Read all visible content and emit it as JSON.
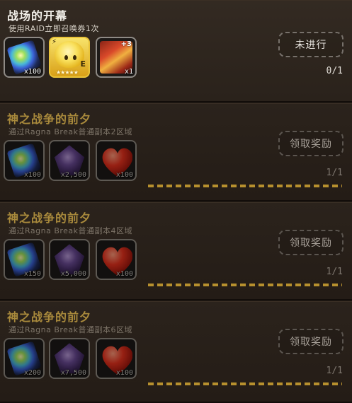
{
  "missions": [
    {
      "title": "战场的开幕",
      "desc": "使用RAID立即召唤券1次",
      "button": "未进行",
      "progress": "0/1",
      "progress_fraction": 0,
      "state": "active",
      "rewards": [
        {
          "icon": "rainbow-crystal-icon",
          "qty": "x100"
        },
        {
          "icon": "yellow-pet-icon",
          "qty": "",
          "stars": "★★★★★",
          "mark": "E"
        },
        {
          "icon": "raid-ticket-icon",
          "qty": "x1",
          "plus": "+3"
        }
      ]
    },
    {
      "title": "神之战争的前夕",
      "desc": "通过Ragna Break普通副本2区域",
      "button": "领取奖励",
      "progress": "1/1",
      "progress_fraction": 1,
      "state": "done",
      "rewards": [
        {
          "icon": "rainbow-crystal-icon",
          "qty": "x100"
        },
        {
          "icon": "purple-crystal-icon",
          "qty": "x2,500"
        },
        {
          "icon": "heart-icon",
          "qty": "x100"
        }
      ]
    },
    {
      "title": "神之战争的前夕",
      "desc": "通过Ragna Break普通副本4区域",
      "button": "领取奖励",
      "progress": "1/1",
      "progress_fraction": 1,
      "state": "done",
      "rewards": [
        {
          "icon": "rainbow-crystal-icon",
          "qty": "x150"
        },
        {
          "icon": "purple-crystal-icon",
          "qty": "x5,000"
        },
        {
          "icon": "heart-icon",
          "qty": "x100"
        }
      ]
    },
    {
      "title": "神之战争的前夕",
      "desc": "通过Ragna Break普通副本6区域",
      "button": "领取奖励",
      "progress": "1/1",
      "progress_fraction": 1,
      "state": "done",
      "rewards": [
        {
          "icon": "rainbow-crystal-icon",
          "qty": "x200"
        },
        {
          "icon": "purple-crystal-icon",
          "qty": "x7,500"
        },
        {
          "icon": "heart-icon",
          "qty": "x100"
        }
      ]
    }
  ]
}
